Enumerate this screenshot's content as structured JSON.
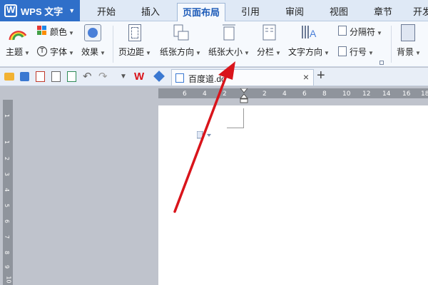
{
  "app": {
    "name": "WPS 文字"
  },
  "tabs": [
    {
      "label": "开始",
      "active": false
    },
    {
      "label": "插入",
      "active": false
    },
    {
      "label": "页面布局",
      "active": true
    },
    {
      "label": "引用",
      "active": false
    },
    {
      "label": "审阅",
      "active": false
    },
    {
      "label": "视图",
      "active": false
    },
    {
      "label": "章节",
      "active": false
    },
    {
      "label": "开发",
      "active": false
    }
  ],
  "ribbon": {
    "theme": "主题",
    "color": "颜色",
    "font": "字体",
    "effect": "效果",
    "margins": "页边距",
    "orientation": "纸张方向",
    "size": "纸张大小",
    "columns": "分栏",
    "text_direction": "文字方向",
    "separator": "分隔符",
    "line_number": "行号",
    "background": "背景"
  },
  "document_tab": {
    "name": "百度道.do"
  },
  "h_ruler_labels": [
    "6",
    "4",
    "2",
    "2",
    "4",
    "6",
    "8",
    "10",
    "12",
    "14",
    "16",
    "18"
  ],
  "v_ruler_labels": [
    "1",
    "1",
    "2",
    "3",
    "4",
    "5",
    "6",
    "7",
    "8",
    "9",
    "10"
  ],
  "colors": {
    "accent": "#2f6fc9",
    "arrow": "#d9141b",
    "ruler": "#8f949c",
    "workspace": "#bfc3cc"
  }
}
